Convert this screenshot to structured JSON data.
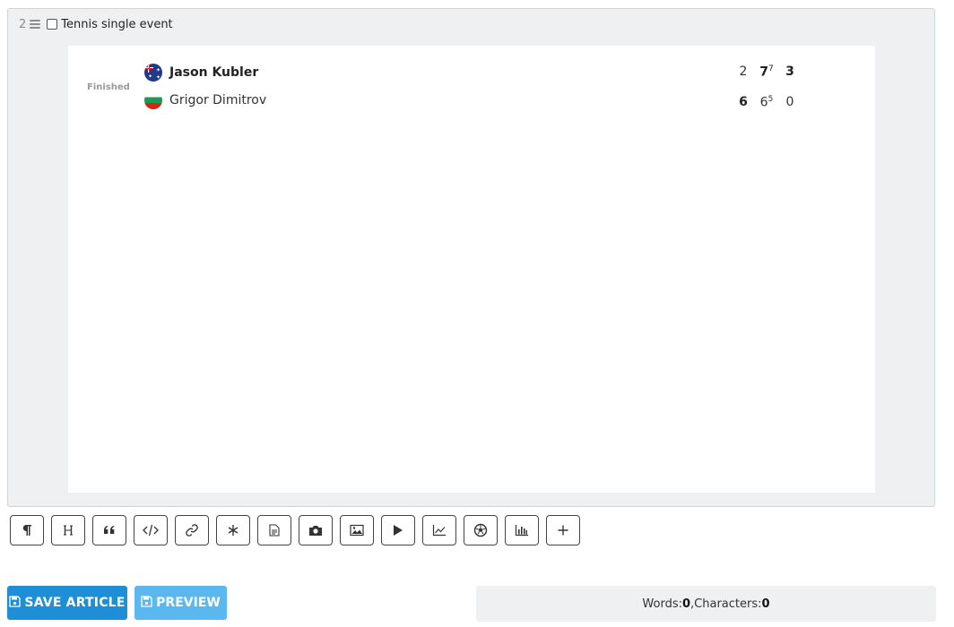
{
  "block": {
    "number": "2",
    "title": "Tennis single event"
  },
  "match": {
    "status": "Finished",
    "player1": {
      "name": "Jason Kubler",
      "flag": "australia-flag",
      "winner": true
    },
    "player2": {
      "name": "Grigor Dimitrov",
      "flag": "bulgaria-flag",
      "winner": false
    },
    "sets": [
      {
        "p1": "2",
        "p2": "6",
        "p1_tb": "",
        "p2_tb": ""
      },
      {
        "p1": "7",
        "p2": "6",
        "p1_tb": "7",
        "p2_tb": "5"
      },
      {
        "p1": "3",
        "p2": "0",
        "p1_tb": "",
        "p2_tb": ""
      }
    ]
  },
  "toolbar": {
    "buttons": [
      "paragraph-icon",
      "heading-icon",
      "quote-icon",
      "code-icon",
      "link-icon",
      "asterisk-icon",
      "document-icon",
      "camera-icon",
      "image-icon",
      "play-icon",
      "line-chart-icon",
      "football-icon",
      "bar-chart-icon",
      "plus-icon"
    ]
  },
  "actions": {
    "save_label": "SAVE ARTICLE",
    "preview_label": "PREVIEW"
  },
  "counter": {
    "words_label": "Words: ",
    "words_value": "0",
    "chars_label": ",Characters: ",
    "chars_value": "0"
  },
  "colors": {
    "primary": "#1e8fd6",
    "primary_light": "#5ab8ee",
    "panel": "#eef0f2"
  }
}
